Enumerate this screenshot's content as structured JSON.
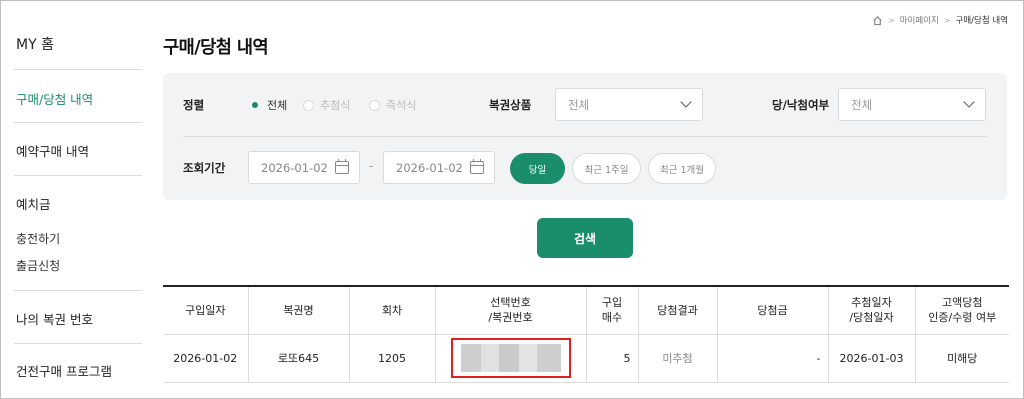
{
  "sidebar": {
    "home": "MY 홈",
    "items": [
      {
        "label": "구매/당첨 내역",
        "active": true
      },
      {
        "label": "예약구매 내역"
      },
      {
        "label": "예치금"
      },
      {
        "label": "나의 복권 번호"
      },
      {
        "label": "건전구매 프로그램"
      }
    ],
    "sub_items": [
      "충전하기",
      "출금신청"
    ]
  },
  "breadcrumb": [
    "마이페이지",
    "구매/당첨 내역"
  ],
  "page_title": "구매/당첨 내역",
  "filters": {
    "sort_label": "정렬",
    "sort_options": [
      "전체",
      "추첨식",
      "즉석식"
    ],
    "sort_selected": "전체",
    "product_label": "복권상품",
    "product_value": "전체",
    "win_label": "당/낙첨여부",
    "win_value": "전체",
    "period_label": "조회기간",
    "date_from": "2026-01-02",
    "date_sep": "-",
    "date_to": "2026-01-02",
    "quick_ranges": [
      "당일",
      "최근 1주일",
      "최근 1개월"
    ],
    "quick_selected": "당일"
  },
  "search_button": "검색",
  "table": {
    "headers": [
      "구입일자",
      "복권명",
      "회차",
      "선택번호\n/복권번호",
      "구입\n매수",
      "당첨결과",
      "당첨금",
      "추첨일자\n/당첨일자",
      "고액당첨\n인증/수령 여부"
    ],
    "rows": [
      [
        "2026-01-02",
        "로또645",
        "1205",
        "",
        "5",
        "미추첨",
        "-",
        "2026-01-03",
        "미해당"
      ]
    ]
  },
  "colors": {
    "accent": "#1a8d6c",
    "highlight": "#e02020"
  }
}
